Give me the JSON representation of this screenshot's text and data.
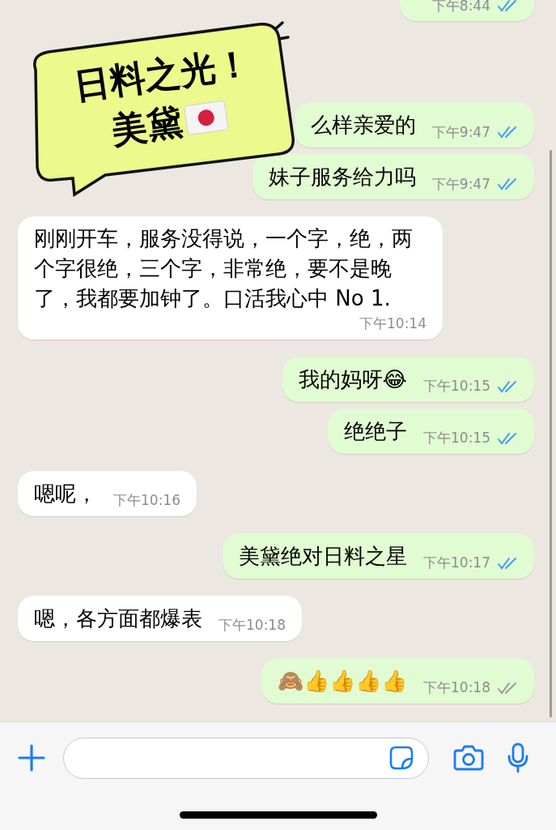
{
  "sticker": {
    "lines": [
      "日料之光！",
      "美黛"
    ]
  },
  "messages": [
    {
      "kind": "outgoing",
      "time": "下午8:44",
      "read": true
    },
    {
      "kind": "outgoing",
      "text": "么样亲爱的",
      "time": "下午9:47",
      "read": true
    },
    {
      "kind": "outgoing",
      "text": "妹子服务给力吗",
      "time": "下午9:47",
      "read": true
    },
    {
      "kind": "incoming",
      "text": "刚刚开车，服务没得说，一个字，绝，两个字很绝，三个字，非常绝，要不是晚了，我都要加钟了。口活我心中 No 1.",
      "time": "下午10:14"
    },
    {
      "kind": "outgoing",
      "text": "我的妈呀😂",
      "time": "下午10:15",
      "read": true
    },
    {
      "kind": "outgoing",
      "text": "绝绝子",
      "time": "下午10:15",
      "read": true
    },
    {
      "kind": "incoming",
      "text": "嗯呢，",
      "time": "下午10:16"
    },
    {
      "kind": "outgoing",
      "text": "美黛绝对日料之星",
      "time": "下午10:17",
      "read": true
    },
    {
      "kind": "incoming",
      "text": "嗯，各方面都爆表",
      "time": "下午10:18"
    },
    {
      "kind": "outgoing",
      "text": "🙈👍👍👍👍",
      "time": "下午10:18",
      "read": false
    }
  ]
}
